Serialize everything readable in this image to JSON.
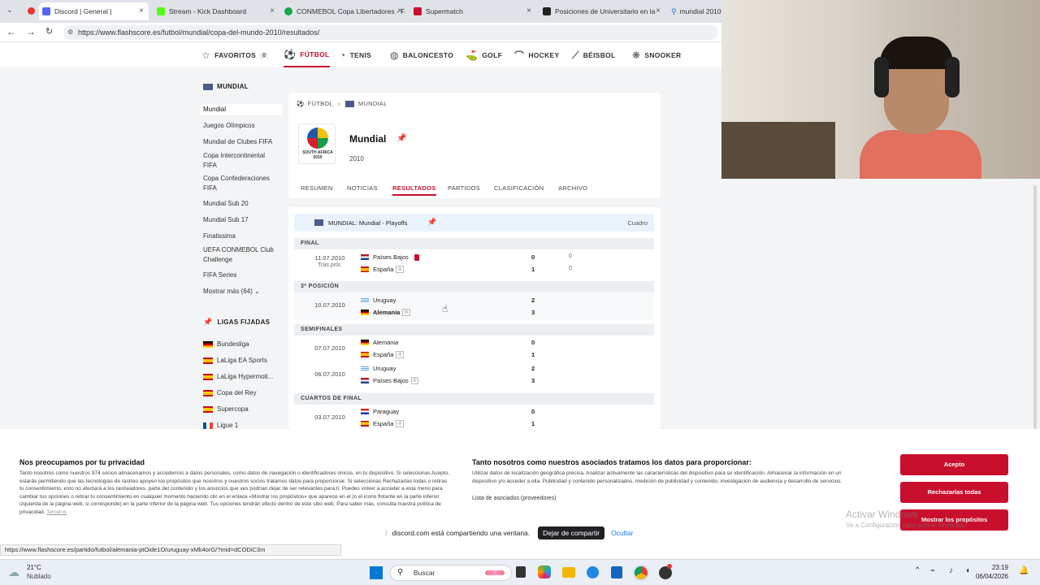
{
  "browser": {
    "tabs": [
      {
        "title": "Discord | General |",
        "color": "#5865f2"
      },
      {
        "title": "Stream - Kick Dashboard",
        "color": "#53fc18"
      },
      {
        "title": "CONMEBOL Copa Libertadores - F",
        "color": "#1aa64a"
      },
      {
        "title": "Supermatch",
        "color": "#c8102e"
      },
      {
        "title": "Posiciones de Universitario en la",
        "color": "#222222"
      },
      {
        "title": "mundial 2010",
        "color": "#1a73e8"
      }
    ],
    "url": "https://www.flashscore.es/futbol/mundial/copa-del-mundo-2010/resultados/"
  },
  "sports_nav": [
    {
      "label": "FAVORITOS",
      "badge": "0",
      "icon": "star-icon"
    },
    {
      "label": "FÚTBOL",
      "icon": "football-icon",
      "active": true
    },
    {
      "label": "TENIS",
      "icon": "tennis-icon"
    },
    {
      "label": "BALONCESTO",
      "icon": "basketball-icon"
    },
    {
      "label": "GOLF",
      "icon": "golf-icon"
    },
    {
      "label": "HOCKEY",
      "icon": "hockey-icon"
    },
    {
      "label": "BÉISBOL",
      "icon": "baseball-icon"
    },
    {
      "label": "SNOOKER",
      "icon": "snooker-icon"
    }
  ],
  "sidebar": {
    "section_title": "MUNDIAL",
    "items": [
      "Mundial",
      "Juegos Olímpicos",
      "Mundial de Clubes FIFA",
      "Copa Intercontinental FIFA",
      "Copa Confederaciones FIFA",
      "Mundial Sub 20",
      "Mundial Sub 17",
      "Finalissima",
      "UEFA CONMEBOL Club Challenge",
      "FIFA Series"
    ],
    "show_more": "Mostrar más (64)",
    "pinned_title": "LIGAS FIJADAS",
    "pinned": [
      "Bundesliga",
      "LaLiga EA Sports",
      "LaLiga Hypermoti...",
      "Copa del Rey",
      "Supercopa",
      "Ligue 1"
    ]
  },
  "header": {
    "breadcrumb_sport": "FÚTBOL",
    "breadcrumb_comp": "MUNDIAL",
    "title": "Mundial",
    "year": "2010",
    "logo_text": "SOUTH AFRICA 2010",
    "tabs": [
      "RESUMEN",
      "NOTICIAS",
      "RESULTADOS",
      "PARTIDOS",
      "CLASIFICACIÓN",
      "ARCHIVO"
    ],
    "active_tab": "RESULTADOS"
  },
  "results": {
    "title": "MUNDIAL: Mundial - Playoffs",
    "bracket_link": "Cuadro",
    "stages": {
      "final": "FINAL",
      "third": "3ª POSICIÓN",
      "semis": "SEMIFINALES",
      "quarters": "CUARTOS DE FINAL"
    },
    "matches": [
      {
        "date": "11.07.2010",
        "note": "Tras prór.",
        "home": "Países Bajos",
        "away": "España",
        "hs": "0",
        "as": "1",
        "hs2": "0",
        "as2": "0"
      },
      {
        "date": "10.07.2010",
        "home": "Uruguay",
        "away": "Alemania",
        "hs": "2",
        "as": "3"
      },
      {
        "date": "07.07.2010",
        "home": "Alemania",
        "away": "España",
        "hs": "0",
        "as": "1"
      },
      {
        "date": "06.07.2010",
        "home": "Uruguay",
        "away": "Países Bajos",
        "hs": "2",
        "as": "3"
      },
      {
        "date": "03.07.2010",
        "home": "Paraguay",
        "away": "España",
        "hs": "0",
        "as": "1"
      }
    ]
  },
  "privacy": {
    "title1": "Nos preocupamos por tu privacidad",
    "text1": "Tanto nosotros como nuestros 974 socios almacenamos y accedemos a datos personales, como datos de navegación o identificadores únicos, en tu dispositivo. Si seleccionas Acepto, estarás permitiendo que las tecnologías de rastreo apoyen los propósitos que nosotros y nuestros socios tratamos datos para proporcionar. Si seleccionas Rechazarlas todas o retiras tu consentimiento, esto no afectará a los rastreadores, parte del contenido y los anuncios que ves podrían dejar de ser relevantes para ti. Puedes volver a acceder a esta menú para cambiar tus opciones o retirar tu consentimiento en cualquier momento haciendo clic en el enlace «Mostrar los propósitos» que aparece en el (o el icono flotante en la parte inferior izquierda de la página web, si corresponde) en la parte inferior de la página web. Tus opciones tendrán efecto dentro de este sitio web. Para saber más, consulta nuestra política de privacidad.",
    "third_link": "Terceros",
    "title2": "Tanto nosotros como nuestros asociados tratamos los datos para proporcionar:",
    "text2": "Utilizar datos de localización geográfica precisa. Analizar activamente las características del dispositivo para su identificación. Almacenar la información en un dispositivo y/o acceder a ella. Publicidad y contenido personalizados, medición de publicidad y contenido, investigación de audiencia y desarrollo de servicios.",
    "partners_link": "Lista de asociados (proveedores)",
    "accept": "Acepto",
    "reject": "Rechazarlas todas",
    "purposes": "Mostrar los propósitos"
  },
  "windows_activation": {
    "line1": "Activar Windows",
    "line2": "Ve a Configuración para activar Windows."
  },
  "status_url": "https://www.flashscore.es/partido/futbol/alemania-ptOide1O/uruguay-xMk4orG/?mid=dCODiC3m",
  "share": {
    "text": "discord.com está compartiendo una ventana.",
    "stop": "Dejar de compartir",
    "hide": "Ocultar"
  },
  "taskbar": {
    "temp": "21°C",
    "weather": "Nublado",
    "search": "Buscar",
    "time": "23:19",
    "date": "06/04/2026"
  }
}
